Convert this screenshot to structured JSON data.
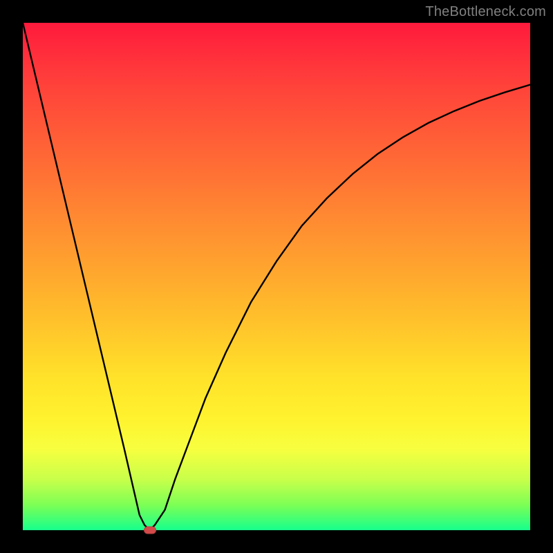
{
  "attribution": "TheBottleneck.com",
  "chart_data": {
    "type": "line",
    "title": "",
    "xlabel": "",
    "ylabel": "",
    "xlim": [
      0,
      100
    ],
    "ylim": [
      0,
      100
    ],
    "x": [
      0,
      5,
      10,
      15,
      20,
      23,
      24,
      25,
      26,
      28,
      30,
      33,
      36,
      40,
      45,
      50,
      55,
      60,
      65,
      70,
      75,
      80,
      85,
      90,
      95,
      100
    ],
    "values": [
      100,
      79,
      58,
      37,
      16,
      3,
      1,
      0,
      1,
      4,
      10,
      18,
      26,
      35,
      45,
      53,
      60,
      65.5,
      70.2,
      74.2,
      77.5,
      80.3,
      82.6,
      84.6,
      86.3,
      87.8
    ],
    "marker": {
      "x": 25,
      "y": 0
    },
    "background_gradient": {
      "top": "#ff1a3c",
      "mid_upper": "#ff9e2f",
      "mid_lower": "#fff22e",
      "bottom": "#16ff8c"
    }
  }
}
